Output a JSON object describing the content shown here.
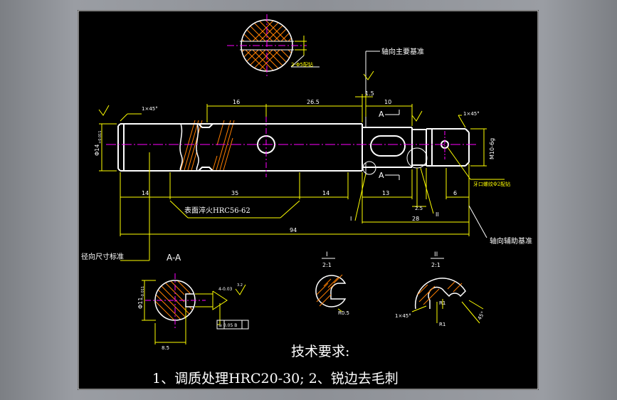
{
  "drawing": {
    "section_top_label": "2-Φ5配钻",
    "axial_main_datum": "轴向主要基准",
    "axial_aux_datum": "轴向辅助基准",
    "radial_datum": "径向尺寸标准",
    "thread_hole_label": "牙口螺纹Φ2配钻",
    "hardening_note": "表面淬火HRC56-62",
    "chamfer_left": "1×45°",
    "chamfer_right": "1×45°",
    "dia_left": "Φ14",
    "dia_left_tol": "+0.011",
    "thread_dim": "M10-6g",
    "dim_16": "16",
    "dim_26_5": "26.5",
    "dim_1_5": "1.5",
    "dim_10": "10",
    "dim_14a": "14",
    "dim_35": "35",
    "dim_14b": "14",
    "dim_13": "13",
    "dim_6": "6",
    "dim_2_5": "2.5",
    "dim_28": "28",
    "dim_94": "94",
    "mark_I": "I",
    "mark_II": "II",
    "section_A_top": "A",
    "section_A_bottom": "A",
    "section_title": "A-A",
    "dia_section": "Φ11",
    "dia_section_tol": "-0.011",
    "width_section": "8.5",
    "keyway_tol": "4-0.03",
    "tolerance_box": "≡ 0.05 B",
    "roughness": "3.2",
    "detail_I_title": "I",
    "detail_I_scale": "2:1",
    "detail_II_title": "II",
    "detail_II_scale": "2:1",
    "r_05": "R0.5",
    "r_1a": "R1",
    "r_1b": "R1",
    "chamfer_detail": "1×45°",
    "angle_45": "45°",
    "tech_title": "技术要求:",
    "tech_req": "1、调质处理HRC20-30;    2、锐边去毛刺",
    "colors": {
      "background": "#000000",
      "outline": "#ffffff",
      "dimension": "#ffff00",
      "centerline": "#ff00ff",
      "hatch": "#ff7f00",
      "leader": "#ffffff"
    }
  }
}
